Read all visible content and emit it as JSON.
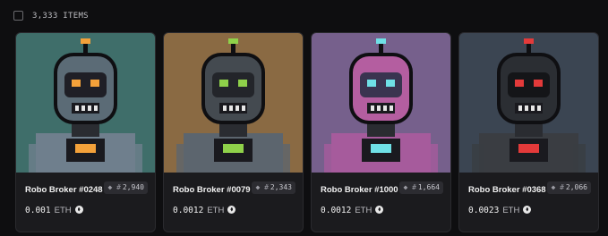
{
  "header": {
    "items_count": "3,333 ITEMS"
  },
  "cards": [
    {
      "name": "Robo Broker #0248",
      "rank": "2,940",
      "price": "0.001",
      "currency": "ETH",
      "colors": {
        "bg": "#3f6e6a",
        "head": "#5b6b76",
        "visor": "#1f1f26",
        "eyes": "#f3a13a",
        "body": "#6f7f8d"
      }
    },
    {
      "name": "Robo Broker #0079",
      "rank": "2,343",
      "price": "0.0012",
      "currency": "ETH",
      "colors": {
        "bg": "#8a6a43",
        "head": "#444a50",
        "visor": "#23252a",
        "eyes": "#8fd14a",
        "body": "#5c656e"
      }
    },
    {
      "name": "Robo Broker #1000",
      "rank": "1,664",
      "price": "0.0012",
      "currency": "ETH",
      "colors": {
        "bg": "#76608c",
        "head": "#b45ea0",
        "visor": "#3a3450",
        "eyes": "#6fe0e6",
        "body": "#a65b9c"
      }
    },
    {
      "name": "Robo Broker #0368",
      "rank": "2,066",
      "price": "0.0023",
      "currency": "ETH",
      "colors": {
        "bg": "#3b4552",
        "head": "#2b2e33",
        "visor": "#141518",
        "eyes": "#e33a3a",
        "body": "#3a3d42"
      }
    }
  ]
}
